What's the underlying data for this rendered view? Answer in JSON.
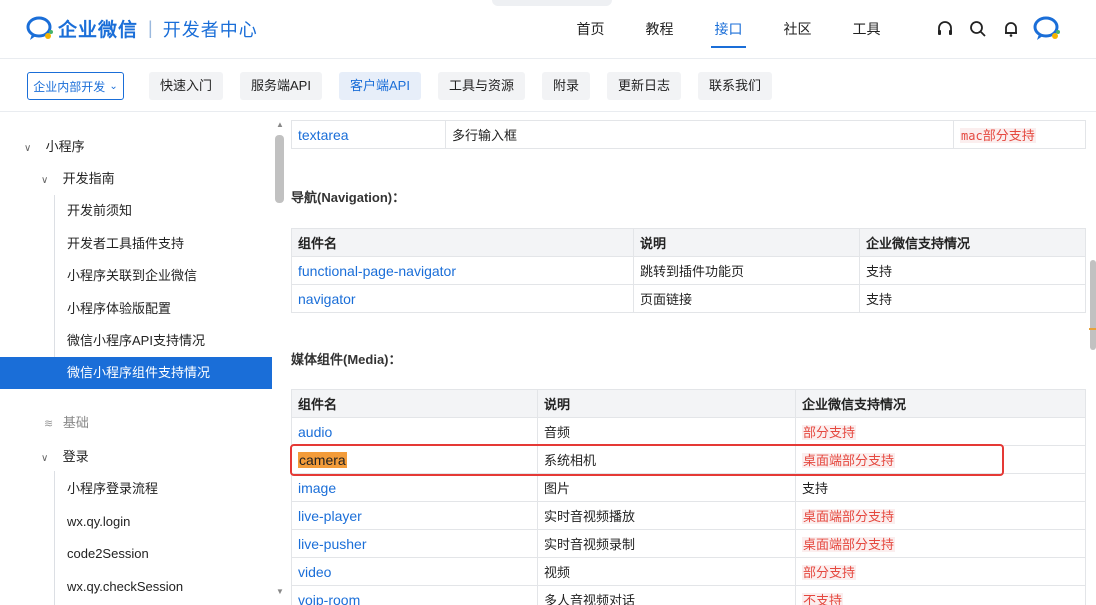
{
  "header": {
    "brand": "企业微信",
    "separator": "|",
    "subtitle": "开发者中心",
    "nav": [
      "首页",
      "教程",
      "接口",
      "社区",
      "工具"
    ],
    "active_nav": "接口",
    "icons": [
      "headset-icon",
      "search-icon",
      "bell-icon",
      "avatar-icon"
    ]
  },
  "subheader": {
    "dropdown_label": "企业内部开发",
    "chips": [
      "快速入门",
      "服务端API",
      "客户端API",
      "工具与资源",
      "附录",
      "更新日志",
      "联系我们"
    ],
    "active_chip": "客户端API"
  },
  "sidebar": {
    "items": [
      {
        "label": "小程序",
        "level": 1,
        "caret": "∨"
      },
      {
        "label": "开发指南",
        "level": 2,
        "caret": "∨"
      },
      {
        "label": "开发前须知",
        "level": 3
      },
      {
        "label": "开发者工具插件支持",
        "level": 3
      },
      {
        "label": "小程序关联到企业微信",
        "level": 3
      },
      {
        "label": "小程序体验版配置",
        "level": 3
      },
      {
        "label": "微信小程序API支持情况",
        "level": 3
      },
      {
        "label": "微信小程序组件支持情况",
        "level": 3,
        "active": true
      },
      {
        "label": "基础",
        "level": 2,
        "muted": true
      },
      {
        "label": "登录",
        "level": 2,
        "caret": "∨"
      },
      {
        "label": "小程序登录流程",
        "level": 3
      },
      {
        "label": "wx.qy.login",
        "level": 3
      },
      {
        "label": "code2Session",
        "level": 3
      },
      {
        "label": "wx.qy.checkSession",
        "level": 3
      }
    ]
  },
  "main": {
    "top_row": {
      "name": "textarea",
      "desc": "多行输入框",
      "support_code": "mac",
      "support_text": "部分支持"
    },
    "nav_section": {
      "title": "导航(Navigation)：",
      "headers": [
        "组件名",
        "说明",
        "企业微信支持情况"
      ],
      "rows": [
        {
          "name": "functional-page-navigator",
          "desc": "跳转到插件功能页",
          "support": "支持",
          "warn": false
        },
        {
          "name": "navigator",
          "desc": "页面链接",
          "support": "支持",
          "warn": false
        }
      ]
    },
    "media_section": {
      "title": "媒体组件(Media)：",
      "headers": [
        "组件名",
        "说明",
        "企业微信支持情况"
      ],
      "rows": [
        {
          "name": "audio",
          "desc": "音频",
          "support": "部分支持",
          "warn": true
        },
        {
          "name": "camera",
          "desc": "系统相机",
          "support": "桌面端部分支持",
          "warn": true,
          "highlight": true
        },
        {
          "name": "image",
          "desc": "图片",
          "support": "支持",
          "warn": false
        },
        {
          "name": "live-player",
          "desc": "实时音视频播放",
          "support": "桌面端部分支持",
          "warn": true
        },
        {
          "name": "live-pusher",
          "desc": "实时音视频录制",
          "support": "桌面端部分支持",
          "warn": true
        },
        {
          "name": "video",
          "desc": "视频",
          "support": "部分支持",
          "warn": true
        },
        {
          "name": "voip-room",
          "desc": "多人音视频对话",
          "support": "不支持",
          "warn": true
        }
      ]
    }
  }
}
